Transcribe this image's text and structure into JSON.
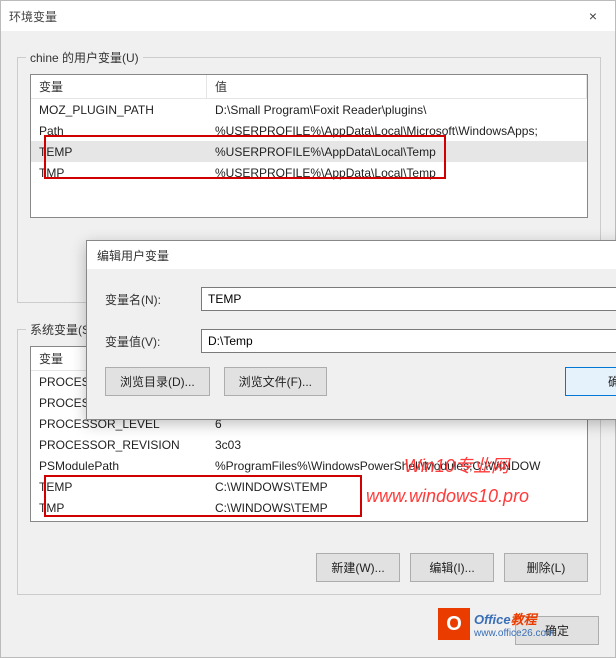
{
  "mainWindow": {
    "title": "环境变量"
  },
  "userGroup": {
    "legend": "chine 的用户变量(U)",
    "colName": "变量",
    "colValue": "值",
    "rows": [
      {
        "name": "MOZ_PLUGIN_PATH",
        "value": "D:\\Small Program\\Foxit Reader\\plugins\\",
        "selected": false
      },
      {
        "name": "Path",
        "value": "%USERPROFILE%\\AppData\\Local\\Microsoft\\WindowsApps;",
        "selected": false
      },
      {
        "name": "TEMP",
        "value": "%USERPROFILE%\\AppData\\Local\\Temp",
        "selected": true
      },
      {
        "name": "TMP",
        "value": "%USERPROFILE%\\AppData\\Local\\Temp",
        "selected": false
      }
    ]
  },
  "sysGroup": {
    "legend": "系统变量(S)",
    "colName": "变量",
    "rows": [
      {
        "name": "PROCESSO",
        "value": ""
      },
      {
        "name": "PROCESSO",
        "value": ""
      },
      {
        "name": "PROCESSOR_LEVEL",
        "value": "6"
      },
      {
        "name": "PROCESSOR_REVISION",
        "value": "3c03"
      },
      {
        "name": "PSModulePath",
        "value": "%ProgramFiles%\\WindowsPowerShell\\Modules;C:\\WINDOW"
      },
      {
        "name": "TEMP",
        "value": "C:\\WINDOWS\\TEMP"
      },
      {
        "name": "TMP",
        "value": "C:\\WINDOWS\\TEMP"
      }
    ],
    "buttons": {
      "new": "新建(W)...",
      "edit": "编辑(I)...",
      "delete": "删除(L)"
    }
  },
  "editDialog": {
    "title": "编辑用户变量",
    "labelName": "变量名(N):",
    "labelValue": "变量值(V):",
    "valueName": "TEMP",
    "valueValue": "D:\\Temp",
    "browseDir": "浏览目录(D)...",
    "browseFile": "浏览文件(F)...",
    "ok": "确定"
  },
  "bottom": {
    "ok": "确定"
  },
  "watermarks": {
    "w1": "Win10专业网",
    "w2": "www.windows10.pro"
  },
  "officeLogo": {
    "sq": "O",
    "line1a": "Office",
    "line1b": "教程",
    "line2": "www.office26.com"
  }
}
